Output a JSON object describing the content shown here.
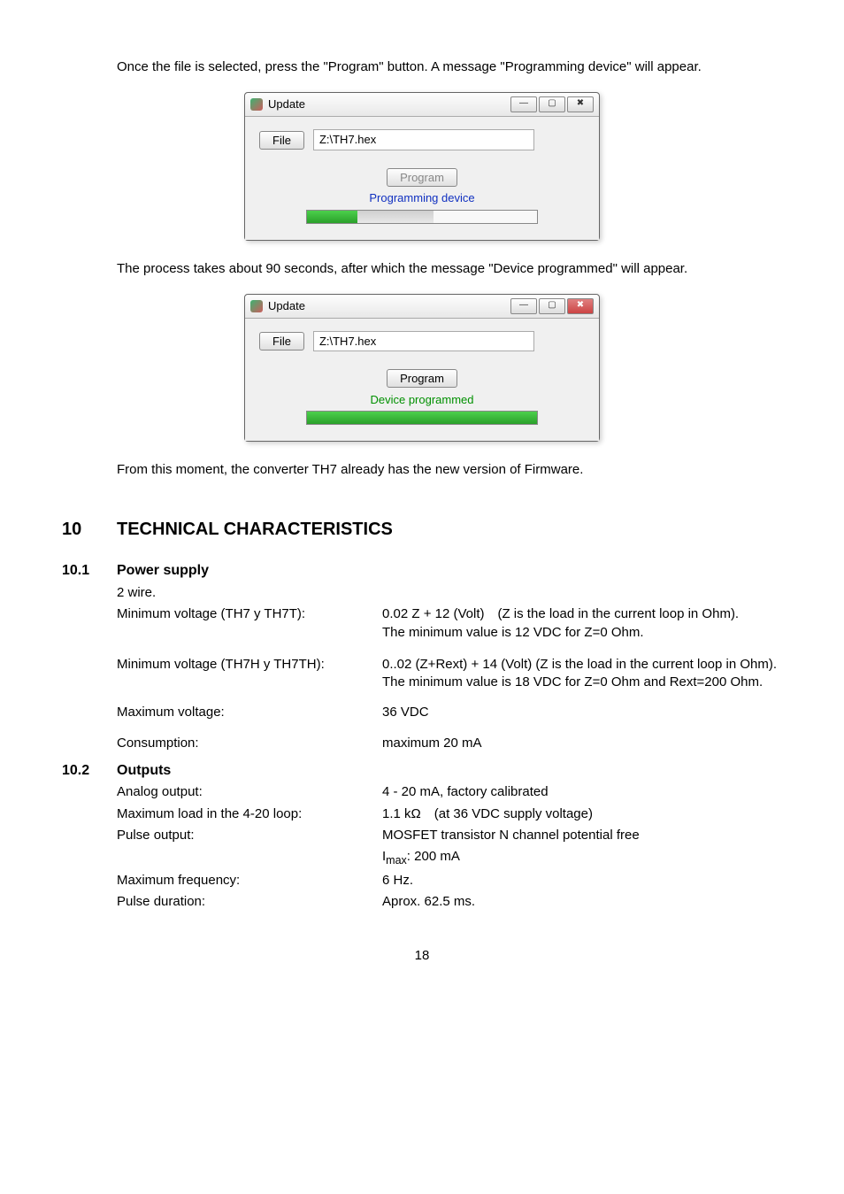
{
  "intro1": "Once the file is selected, press the \"Program\" button. A message \"Programming device\" will appear.",
  "dialog1": {
    "title": "Update",
    "fileBtn": "File",
    "path": "Z:\\TH7.hex",
    "programBtn": "Program",
    "status": "Programming device",
    "progressGreen": 22,
    "progressGreyStart": 22,
    "progressGreyEnd": 55
  },
  "intro2": "The process takes about 90 seconds, after which the message \"Device programmed\" will appear.",
  "dialog2": {
    "title": "Update",
    "fileBtn": "File",
    "path": "Z:\\TH7.hex",
    "programBtn": "Program",
    "status": "Device programmed",
    "progressGreen": 100
  },
  "outro": "From this moment, the converter TH7 already has the new version of Firmware.",
  "sec10": {
    "num": "10",
    "title": "TECHNICAL CHARACTERISTICS"
  },
  "sec101": {
    "num": "10.1",
    "title": "Power supply",
    "rows": [
      {
        "label": "2 wire.",
        "value": ""
      },
      {
        "label": "Minimum voltage (TH7 y TH7T):",
        "value": "0.02 Z + 12 (Volt) (Z is the load in the current loop in Ohm).\nThe minimum value is 12 VDC for  Z=0 Ohm."
      },
      {
        "label": "Minimum voltage (TH7H y TH7TH):",
        "value": "0..02 (Z+Rext) + 14 (Volt) (Z is the load in the current loop in Ohm).\nThe minimum value is 18 VDC for  Z=0 Ohm and Rext=200 Ohm."
      },
      {
        "label": "Maximum voltage:",
        "value": "36 VDC"
      },
      {
        "label": "Consumption:",
        "value": "maximum 20 mA"
      }
    ]
  },
  "sec102": {
    "num": "10.2",
    "title": "Outputs",
    "rows": [
      {
        "label": "Analog output:",
        "value": "4 - 20 mA, factory calibrated"
      },
      {
        "label": "Maximum load in the 4-20 loop:",
        "value": "1.1 kΩ (at 36 VDC supply voltage)"
      },
      {
        "label": "Pulse output:",
        "value": "MOSFET transistor N channel potential free"
      },
      {
        "label": "",
        "value": "I_max: 200 mA",
        "imax": true
      },
      {
        "label": "Maximum frequency:",
        "value": "6 Hz."
      },
      {
        "label": "Pulse duration:",
        "value": "Aprox. 62.5 ms."
      }
    ]
  },
  "pageNum": "18"
}
